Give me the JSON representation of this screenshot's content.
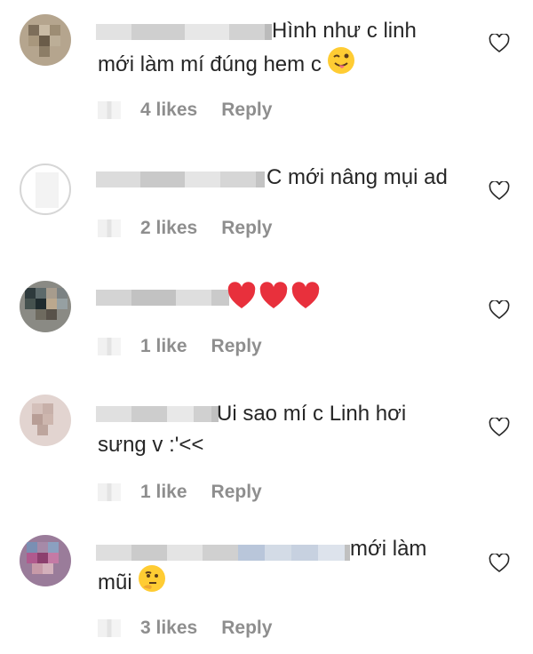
{
  "comments": [
    {
      "text_line1": "Hình như c linh",
      "text_line2": "mới làm mí đúng hem c",
      "emoji": "winking-tongue",
      "likes": "4 likes",
      "reply": "Reply"
    },
    {
      "text_line1": "C mới nâng mụi ad",
      "likes": "2 likes",
      "reply": "Reply"
    },
    {
      "emoji": "three-red-hearts",
      "likes": "1 like",
      "reply": "Reply"
    },
    {
      "text_line1": "Ui sao mí c Linh hơi",
      "text_line2": "sưng v :'<<",
      "likes": "1 like",
      "reply": "Reply"
    },
    {
      "text_line1": "mới làm",
      "text_line2": "mũi",
      "emoji": "thinking-face",
      "likes": "3 likes",
      "reply": "Reply"
    }
  ],
  "colors": {
    "text": "#262626",
    "meta": "#8e8e8e",
    "heart_outline": "#262626",
    "heart_red": "#e8303c"
  }
}
